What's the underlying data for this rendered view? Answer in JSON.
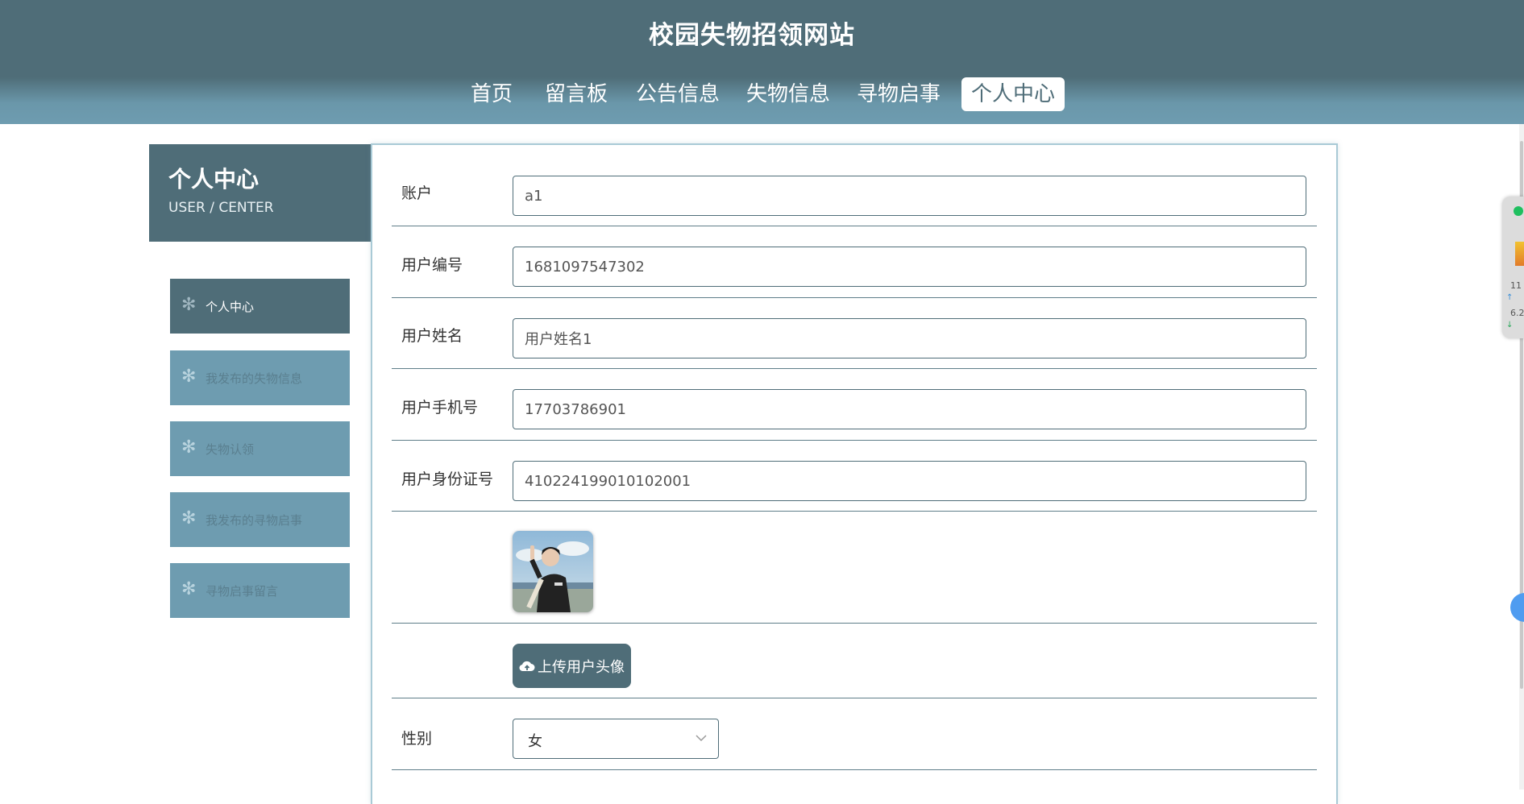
{
  "site": {
    "title": "校园失物招领网站"
  },
  "nav": {
    "items": [
      "首页",
      "留言板",
      "公告信息",
      "失物信息",
      "寻物启事",
      "个人中心"
    ],
    "active": "个人中心"
  },
  "sidebar": {
    "title": "个人中心",
    "subtitle": "USER / CENTER",
    "items": [
      "个人中心",
      "我发布的失物信息",
      "失物认领",
      "我发布的寻物启事",
      "寻物启事留言"
    ]
  },
  "form": {
    "fields": [
      {
        "label": "账户",
        "value": "a1"
      },
      {
        "label": "用户编号",
        "value": "1681097547302"
      },
      {
        "label": "用户姓名",
        "value": "用户姓名1"
      },
      {
        "label": "用户手机号",
        "value": "17703786901"
      },
      {
        "label": "用户身份证号",
        "value": "410224199010102001"
      }
    ],
    "upload_label": "上传用户头像",
    "gender": {
      "label": "性别",
      "value": "女"
    }
  },
  "widget": {
    "upload_speed": "11",
    "download_speed": "6.2"
  },
  "icons": {
    "sidebar_item": "snowflake-icon",
    "upload": "cloud-upload-icon",
    "select": "chevron-down-icon"
  },
  "colors": {
    "primary": "#4f6d78",
    "secondary": "#6e9cb0",
    "white": "#ffffff"
  }
}
